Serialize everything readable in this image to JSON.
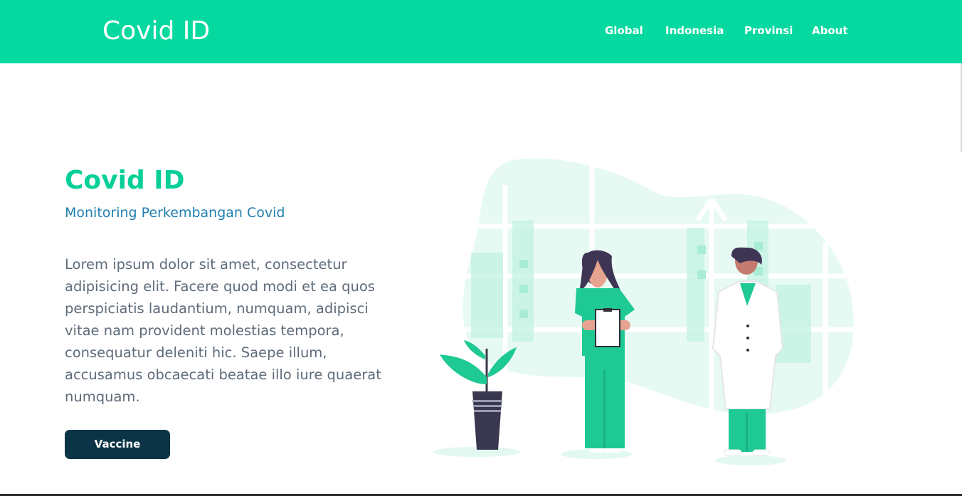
{
  "header": {
    "brand": "Covid ID",
    "nav": [
      {
        "label": "Global"
      },
      {
        "label": "Indonesia"
      },
      {
        "label": "Provinsi"
      },
      {
        "label": "About"
      }
    ]
  },
  "hero": {
    "title": "Covid ID",
    "subtitle": "Monitoring Perkembangan Covid",
    "body": "Lorem ipsum dolor sit amet, consectetur adipisicing elit. Facere quod modi et ea quos perspiciatis laudantium, numquam, adipisci vitae nam provident molestias tempora, consequatur deleniti hic. Saepe illum, accusamus obcaecati beatae illo iure quaerat numquam.",
    "button_label": "Vaccine"
  },
  "colors": {
    "accent": "#06d9a0",
    "title": "#06cf97",
    "subtitle": "#1f7fb0",
    "button": "#0b3547",
    "text": "#5e6b7a"
  },
  "icons": {
    "illustration": "medical-staff-illustration"
  }
}
